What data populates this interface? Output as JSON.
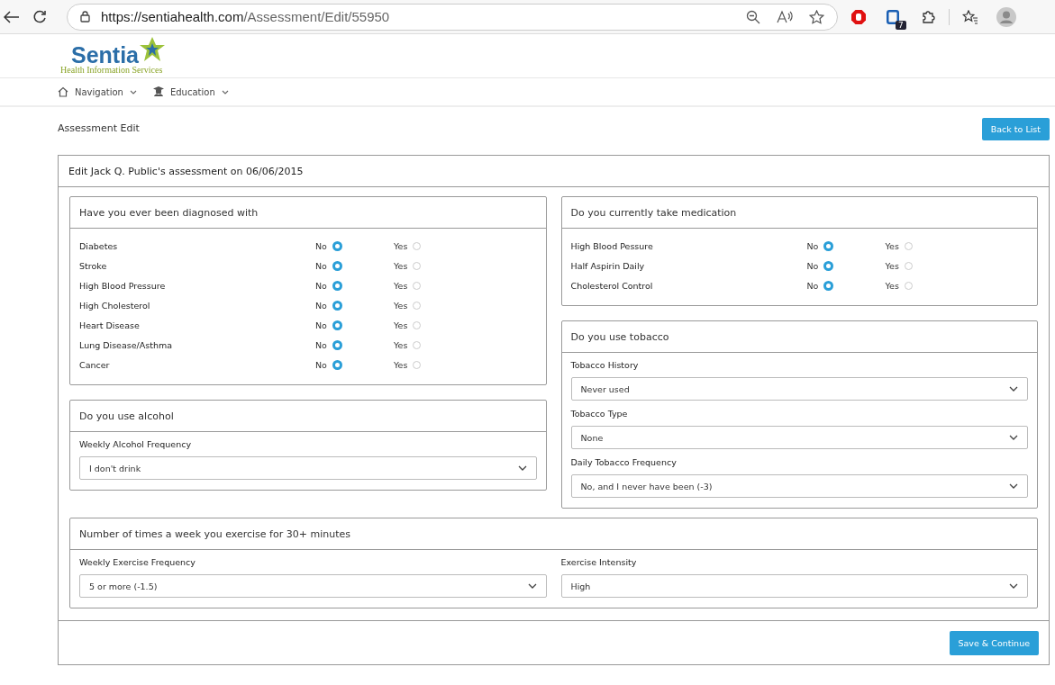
{
  "browser": {
    "url_host": "https://sentiahealth.com",
    "url_path": "/Assessment/Edit/55950",
    "extension_badge": "7"
  },
  "logo": {
    "name": "Sentia",
    "tagline": "Health Information Services"
  },
  "nav": [
    {
      "label": "Navigation",
      "kind": "home"
    },
    {
      "label": "Education",
      "kind": "education"
    }
  ],
  "page_title": "Assessment Edit",
  "back_button": "Back to List",
  "card_title": "Edit Jack Q. Public's assessment on 06/06/2015",
  "diagnosed": {
    "title": "Have you ever been diagnosed with",
    "rows": [
      {
        "label": "Diabetes",
        "options": [
          {
            "label": "No",
            "selected": true
          },
          {
            "label": "Yes",
            "selected": false
          }
        ]
      },
      {
        "label": "Stroke",
        "options": [
          {
            "label": "No",
            "selected": true
          },
          {
            "label": "Yes",
            "selected": false
          }
        ]
      },
      {
        "label": "High Blood Pressure",
        "options": [
          {
            "label": "No",
            "selected": true
          },
          {
            "label": "Yes",
            "selected": false
          }
        ]
      },
      {
        "label": "High Cholesterol",
        "options": [
          {
            "label": "No",
            "selected": true
          },
          {
            "label": "Yes",
            "selected": false
          }
        ]
      },
      {
        "label": "Heart Disease",
        "options": [
          {
            "label": "No",
            "selected": true
          },
          {
            "label": "Yes",
            "selected": false
          }
        ]
      },
      {
        "label": "Lung Disease/Asthma",
        "options": [
          {
            "label": "No",
            "selected": true
          },
          {
            "label": "Yes",
            "selected": false
          }
        ]
      },
      {
        "label": "Cancer",
        "options": [
          {
            "label": "No",
            "selected": true
          },
          {
            "label": "Yes",
            "selected": false
          }
        ]
      }
    ]
  },
  "alcohol": {
    "title": "Do you use alcohol",
    "fields": [
      {
        "label": "Weekly Alcohol Frequency",
        "value": "I don't drink"
      }
    ]
  },
  "medication": {
    "title": "Do you currently take medication",
    "rows": [
      {
        "label": "High Blood Pessure",
        "options": [
          {
            "label": "No",
            "selected": true
          },
          {
            "label": "Yes",
            "selected": false
          }
        ]
      },
      {
        "label": "Half Aspirin Daily",
        "options": [
          {
            "label": "No",
            "selected": true
          },
          {
            "label": "Yes",
            "selected": false
          }
        ]
      },
      {
        "label": "Cholesterol Control",
        "options": [
          {
            "label": "No",
            "selected": true
          },
          {
            "label": "Yes",
            "selected": false
          }
        ]
      }
    ]
  },
  "tobacco": {
    "title": "Do you use tobacco",
    "fields": [
      {
        "label": "Tobacco History",
        "value": "Never used"
      },
      {
        "label": "Tobacco Type",
        "value": "None"
      },
      {
        "label": "Daily Tobacco Frequency",
        "value": "No, and I never have been (-3)"
      }
    ]
  },
  "exercise": {
    "title": "Number of times a week you exercise for 30+ minutes",
    "fields": [
      {
        "label": "Weekly Exercise Frequency",
        "value": "5 or more (-1.5)"
      },
      {
        "label": "Exercise Intensity",
        "value": "High"
      }
    ]
  },
  "save_button": "Save & Continue"
}
